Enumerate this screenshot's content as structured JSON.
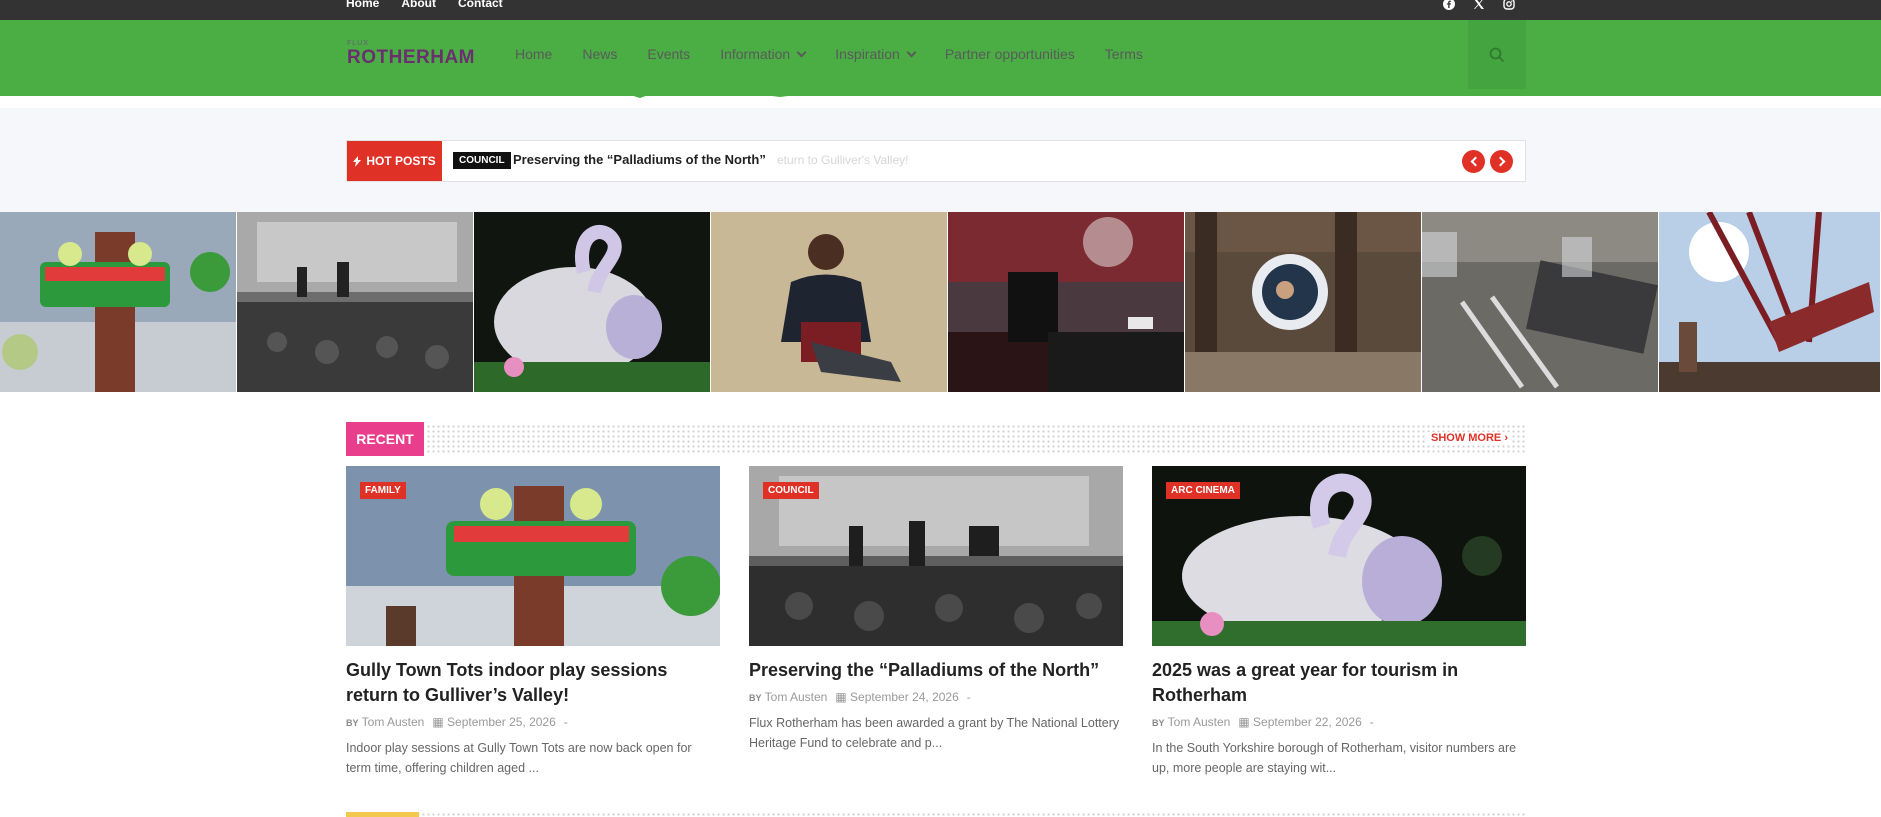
{
  "top_nav": {
    "items": [
      "Home",
      "About",
      "Contact"
    ]
  },
  "social_icons": [
    "facebook-icon",
    "x-twitter-icon",
    "instagram-icon"
  ],
  "logo": {
    "small_text": "FLUX",
    "main_text": "ROTHERHAM"
  },
  "main_nav": {
    "items": [
      {
        "label": "Home",
        "has_dropdown": false
      },
      {
        "label": "News",
        "has_dropdown": false
      },
      {
        "label": "Events",
        "has_dropdown": false
      },
      {
        "label": "Information",
        "has_dropdown": true
      },
      {
        "label": "Inspiration",
        "has_dropdown": true
      },
      {
        "label": "Partner opportunities",
        "has_dropdown": false
      },
      {
        "label": "Terms",
        "has_dropdown": false
      }
    ]
  },
  "ticker": {
    "label": "HOT POSTS",
    "category": "COUNCIL",
    "headline": "Preserving the “Palladiums of the North”",
    "next_headline_faded": "eturn to Gulliver's Valley!"
  },
  "carousel": {
    "slides": [
      "slide-play-ride",
      "slide-vintage-stage",
      "slide-lantern-swan",
      "slide-portrait",
      "slide-concert-dj",
      "slide-egg-chair",
      "slide-dining-table",
      "slide-pirate-ship-ride"
    ]
  },
  "recent": {
    "label": "RECENT",
    "show_more": "SHOW MORE"
  },
  "cards": [
    {
      "category": "FAMILY",
      "title": "Gully Town Tots indoor play sessions return to Gulliver’s Valley!",
      "by": "BY",
      "author": "Tom Austen",
      "date": "September 25, 2026",
      "dash": "-",
      "excerpt": "Indoor play sessions at Gully Town Tots are now back open for term time, offering children aged ..."
    },
    {
      "category": "COUNCIL",
      "title": "Preserving the “Palladiums of the North”",
      "by": "BY",
      "author": "Tom Austen",
      "date": "September 24, 2026",
      "dash": "-",
      "excerpt": "Flux Rotherham has been awarded a grant by The National Lottery Heritage Fund to celebrate and p..."
    },
    {
      "category": "ARC CINEMA",
      "title": "2025 was a great year for tourism in Rotherham",
      "by": "BY",
      "author": "Tom Austen",
      "date": "September 22, 2026",
      "dash": "-",
      "excerpt": "In the South Yorkshire borough of Rotherham, visitor numbers are up, more people are staying wit..."
    }
  ],
  "colors": {
    "header_green": "#4aae45",
    "topbar": "#333333",
    "accent_red": "#e03127",
    "recent_pink": "#e83e8c",
    "logo_purple": "#6b2f6f"
  }
}
